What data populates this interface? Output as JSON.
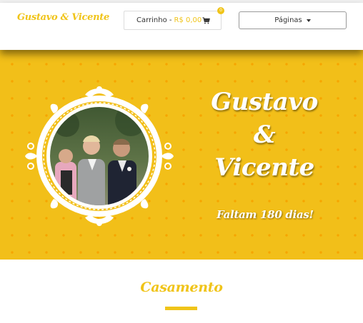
{
  "header": {
    "logo": "Gustavo & Vicente",
    "cart": {
      "label": "Carrinho - ",
      "total": "R$ 0,00",
      "count": "0",
      "icon": "cart-icon"
    },
    "pages_menu": {
      "label": "Páginas",
      "icon": "caret-down-icon"
    }
  },
  "hero": {
    "name1": "Gustavo",
    "ampersand": "&",
    "name2": "Vicente",
    "countdown": "Faltam 180 dias!"
  },
  "section": {
    "title": "Casamento"
  },
  "colors": {
    "accent": "#f0c419",
    "hero_bg": "#f2bf19",
    "dot": "#f6a500"
  }
}
